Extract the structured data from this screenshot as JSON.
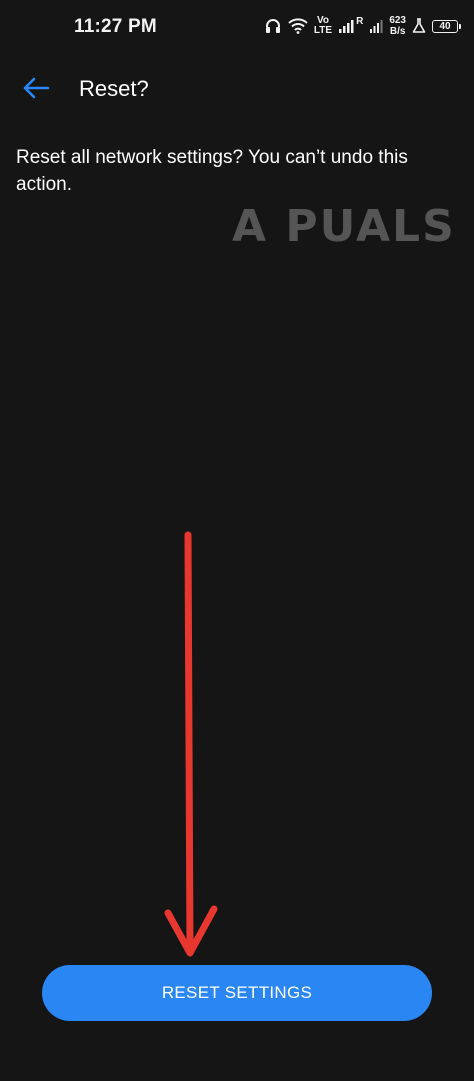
{
  "status_bar": {
    "time": "11:27 PM",
    "volte_top": "Vo",
    "volte_bottom": "LTE",
    "signal_label": "R",
    "speed_value": "623",
    "speed_unit": "B/s",
    "battery_level": "40"
  },
  "header": {
    "title": "Reset?",
    "back_icon": "arrow-left-icon"
  },
  "body": {
    "description": "Reset all network settings? You can’t undo this action."
  },
  "watermark": {
    "text": "A  PUALS"
  },
  "actions": {
    "reset_label": "RESET SETTINGS"
  },
  "colors": {
    "background": "#151516",
    "accent": "#2a86f3",
    "annotation": "#e8372f"
  }
}
